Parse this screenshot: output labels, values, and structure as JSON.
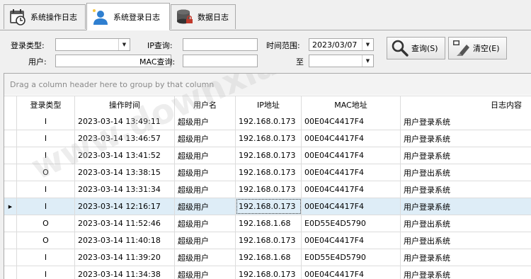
{
  "tabs": [
    {
      "label": "系统操作日志",
      "icon": "calendar-clock-icon"
    },
    {
      "label": "系统登录日志",
      "icon": "user-icon"
    },
    {
      "label": "数据日志",
      "icon": "database-icon"
    }
  ],
  "filter": {
    "login_type_label": "登录类型:",
    "login_type_value": "",
    "user_label": "用户:",
    "user_value": "",
    "ip_label": "IP查询:",
    "ip_value": "",
    "mac_label": "MAC查询:",
    "mac_value": "",
    "time_range_label": "时间范围:",
    "date_from": "2023/03/07",
    "to_label": "至",
    "date_to": "",
    "query_button": "查询(S)",
    "clear_button": "清空(E)"
  },
  "grid": {
    "group_hint": "Drag a column header here to group by that column",
    "columns": [
      "登录类型",
      "操作时间",
      "用户名",
      "IP地址",
      "MAC地址",
      "日志内容"
    ],
    "rows": [
      [
        "I",
        "2023-03-14 13:49:11",
        "超级用户",
        "192.168.0.173",
        "00E04C4417F4",
        "用户登录系统"
      ],
      [
        "I",
        "2023-03-14 13:46:57",
        "超级用户",
        "192.168.0.173",
        "00E04C4417F4",
        "用户登录系统"
      ],
      [
        "I",
        "2023-03-14 13:41:52",
        "超级用户",
        "192.168.0.173",
        "00E04C4417F4",
        "用户登录系统"
      ],
      [
        "O",
        "2023-03-14 13:38:15",
        "超级用户",
        "192.168.0.173",
        "00E04C4417F4",
        "用户登出系统"
      ],
      [
        "I",
        "2023-03-14 13:31:34",
        "超级用户",
        "192.168.0.173",
        "00E04C4417F4",
        "用户登录系统"
      ],
      [
        "I",
        "2023-03-14 12:16:17",
        "超级用户",
        "192.168.0.173",
        "00E04C4417F4",
        "用户登录系统"
      ],
      [
        "O",
        "2023-03-14 11:52:46",
        "超级用户",
        "192.168.1.68",
        "E0D55E4D5790",
        "用户登出系统"
      ],
      [
        "O",
        "2023-03-14 11:40:18",
        "超级用户",
        "192.168.0.173",
        "00E04C4417F4",
        "用户登出系统"
      ],
      [
        "I",
        "2023-03-14 11:39:20",
        "超级用户",
        "192.168.1.68",
        "E0D55E4D5790",
        "用户登录系统"
      ],
      [
        "I",
        "2023-03-14 11:34:38",
        "超级用户",
        "192.168.0.173",
        "00E04C4417F4",
        "用户登录系统"
      ]
    ],
    "selected_row": 5
  },
  "colors": {
    "selected_row": "#deedf7",
    "border": "#a9a9a9",
    "background": "#f0f0f0"
  }
}
